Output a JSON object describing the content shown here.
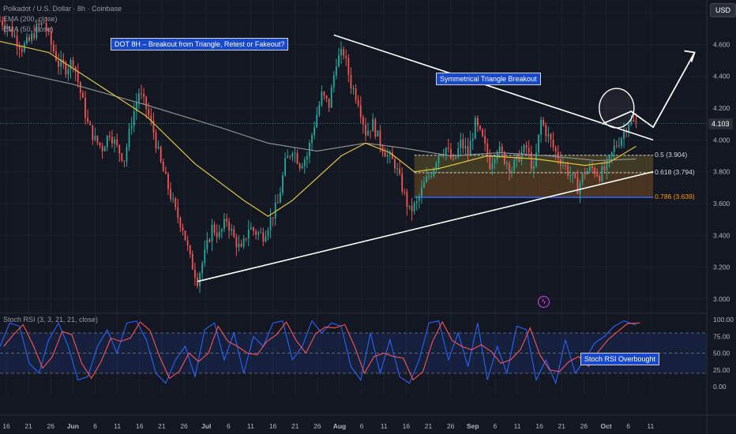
{
  "header": {
    "symbol_line": "Polkadot / U.S. Dollar · 8h · Coinbase",
    "ema200": "EMA (200, close)",
    "ema50": "EMA (50, close)",
    "currency": "USD"
  },
  "annotations": {
    "title": "DOT 8H – Breakout from Triangle, Retest or Fakeout?",
    "triangle": "Symmetrical Triangle Breakout",
    "stoch": "Stoch RSI Overbought"
  },
  "fib": [
    {
      "label": "0.5 (3.904)",
      "value": 3.904,
      "color": "#d1d4dc"
    },
    {
      "label": "0.618 (3.794)",
      "value": 3.794,
      "color": "#d1d4dc"
    },
    {
      "label": "0.786 (3.639)",
      "value": 3.639,
      "color": "#ff9800"
    }
  ],
  "colors": {
    "up": "#26a69a",
    "down": "#ef5350",
    "ema50": "#e0c341",
    "ema200": "#8d8d8d",
    "stochK": "#2962ff",
    "stochD": "#ff5252"
  },
  "chart_data": {
    "type": "candlestick",
    "current_price": 4.103,
    "current_price_label": "4.103",
    "price_ticks": [
      "4.800",
      "4.600",
      "4.400",
      "4.200",
      "4.000",
      "3.800",
      "3.600",
      "3.400",
      "3.200",
      "3.000"
    ],
    "price_tick_values": [
      4.8,
      4.6,
      4.4,
      4.2,
      4.0,
      3.8,
      3.6,
      3.4,
      3.2,
      3.0
    ],
    "ylim": [
      2.92,
      4.88
    ],
    "x_labels": [
      "16",
      "21",
      "26",
      "Jun",
      "6",
      "11",
      "16",
      "21",
      "26",
      "Jul",
      "6",
      "11",
      "16",
      "21",
      "26",
      "Aug",
      "6",
      "11",
      "16",
      "21",
      "26",
      "Sep",
      "6",
      "11",
      "16",
      "21",
      "26",
      "Oct",
      "6",
      "11"
    ],
    "close_path": [
      [
        0,
        4.75
      ],
      [
        3,
        4.72
      ],
      [
        6,
        4.65
      ],
      [
        9,
        4.58
      ],
      [
        12,
        4.62
      ],
      [
        15,
        4.7
      ],
      [
        18,
        4.74
      ],
      [
        21,
        4.6
      ],
      [
        24,
        4.48
      ],
      [
        27,
        4.45
      ],
      [
        30,
        4.5
      ],
      [
        33,
        4.3
      ],
      [
        36,
        4.1
      ],
      [
        39,
        4.0
      ],
      [
        42,
        3.95
      ],
      [
        45,
        4.05
      ],
      [
        48,
        3.95
      ],
      [
        51,
        3.88
      ],
      [
        54,
        4.12
      ],
      [
        57,
        4.3
      ],
      [
        60,
        4.2
      ],
      [
        63,
        4.05
      ],
      [
        66,
        3.85
      ],
      [
        69,
        3.7
      ],
      [
        72,
        3.55
      ],
      [
        75,
        3.45
      ],
      [
        78,
        3.25
      ],
      [
        81,
        3.12
      ],
      [
        84,
        3.28
      ],
      [
        87,
        3.45
      ],
      [
        90,
        3.4
      ],
      [
        93,
        3.5
      ],
      [
        96,
        3.38
      ],
      [
        99,
        3.3
      ],
      [
        102,
        3.45
      ],
      [
        105,
        3.42
      ],
      [
        108,
        3.4
      ],
      [
        111,
        3.5
      ],
      [
        114,
        3.6
      ],
      [
        117,
        3.85
      ],
      [
        120,
        3.95
      ],
      [
        123,
        3.85
      ],
      [
        126,
        3.9
      ],
      [
        129,
        4.1
      ],
      [
        132,
        4.28
      ],
      [
        135,
        4.22
      ],
      [
        138,
        4.5
      ],
      [
        141,
        4.55
      ],
      [
        144,
        4.35
      ],
      [
        147,
        4.25
      ],
      [
        150,
        4.05
      ],
      [
        153,
        4.1
      ],
      [
        156,
        3.98
      ],
      [
        159,
        3.9
      ],
      [
        162,
        3.85
      ],
      [
        165,
        3.7
      ],
      [
        168,
        3.55
      ],
      [
        171,
        3.6
      ],
      [
        174,
        3.72
      ],
      [
        177,
        3.8
      ],
      [
        180,
        3.92
      ],
      [
        183,
        3.95
      ],
      [
        186,
        3.85
      ],
      [
        189,
        3.98
      ],
      [
        192,
        3.92
      ],
      [
        195,
        4.1
      ],
      [
        198,
        4.0
      ],
      [
        201,
        3.85
      ],
      [
        204,
        3.95
      ],
      [
        207,
        3.88
      ],
      [
        210,
        3.82
      ],
      [
        213,
        3.9
      ],
      [
        216,
        3.95
      ],
      [
        219,
        3.8
      ],
      [
        222,
        4.12
      ],
      [
        225,
        4.02
      ],
      [
        228,
        3.92
      ],
      [
        231,
        3.85
      ],
      [
        234,
        3.78
      ],
      [
        237,
        3.7
      ],
      [
        240,
        3.8
      ],
      [
        243,
        3.82
      ],
      [
        246,
        3.78
      ],
      [
        249,
        3.83
      ],
      [
        252,
        3.95
      ],
      [
        255,
        4.02
      ],
      [
        258,
        4.12
      ],
      [
        261,
        4.1
      ]
    ],
    "ema50_path": [
      [
        0,
        4.62
      ],
      [
        20,
        4.55
      ],
      [
        40,
        4.35
      ],
      [
        60,
        4.15
      ],
      [
        80,
        3.85
      ],
      [
        100,
        3.62
      ],
      [
        110,
        3.52
      ],
      [
        120,
        3.62
      ],
      [
        140,
        3.9
      ],
      [
        150,
        3.98
      ],
      [
        160,
        3.92
      ],
      [
        170,
        3.8
      ],
      [
        180,
        3.82
      ],
      [
        200,
        3.9
      ],
      [
        220,
        3.88
      ],
      [
        240,
        3.84
      ],
      [
        250,
        3.86
      ],
      [
        261,
        3.96
      ]
    ],
    "ema200_path": [
      [
        0,
        4.45
      ],
      [
        30,
        4.35
      ],
      [
        60,
        4.22
      ],
      [
        90,
        4.08
      ],
      [
        110,
        3.98
      ],
      [
        130,
        3.93
      ],
      [
        150,
        3.98
      ],
      [
        165,
        3.95
      ],
      [
        185,
        3.9
      ],
      [
        205,
        3.92
      ],
      [
        225,
        3.9
      ],
      [
        245,
        3.87
      ],
      [
        261,
        3.88
      ]
    ],
    "trendlines": [
      {
        "name": "upper",
        "from": [
          137,
          4.66
        ],
        "to": [
          268,
          4.0
        ]
      },
      {
        "name": "lower",
        "from": [
          81,
          3.11
        ],
        "to": [
          268,
          3.8
        ]
      }
    ],
    "fib_zone": {
      "x_from": 170,
      "x_to": 268,
      "top": 3.904,
      "mid": 3.794,
      "bottom": 3.639
    },
    "projection": [
      [
        247,
        4.1
      ],
      [
        259,
        4.18
      ],
      [
        268,
        4.08
      ],
      [
        285,
        4.55
      ]
    ],
    "stoch": {
      "ticks": [
        "100.00",
        "75.00",
        "50.00",
        "25.00",
        "0.00"
      ],
      "tick_values": [
        100,
        75,
        50,
        25,
        0
      ],
      "band": [
        20,
        80
      ],
      "k_path": [
        [
          0,
          60
        ],
        [
          4,
          95
        ],
        [
          8,
          90
        ],
        [
          12,
          35
        ],
        [
          16,
          20
        ],
        [
          20,
          70
        ],
        [
          24,
          95
        ],
        [
          28,
          60
        ],
        [
          32,
          10
        ],
        [
          36,
          15
        ],
        [
          40,
          60
        ],
        [
          44,
          85
        ],
        [
          48,
          50
        ],
        [
          52,
          95
        ],
        [
          56,
          98
        ],
        [
          60,
          70
        ],
        [
          64,
          20
        ],
        [
          68,
          5
        ],
        [
          72,
          40
        ],
        [
          76,
          60
        ],
        [
          80,
          15
        ],
        [
          84,
          85
        ],
        [
          88,
          95
        ],
        [
          92,
          40
        ],
        [
          96,
          80
        ],
        [
          100,
          20
        ],
        [
          104,
          75
        ],
        [
          108,
          60
        ],
        [
          112,
          95
        ],
        [
          116,
          98
        ],
        [
          120,
          40
        ],
        [
          124,
          60
        ],
        [
          128,
          98
        ],
        [
          132,
          80
        ],
        [
          136,
          95
        ],
        [
          140,
          90
        ],
        [
          144,
          30
        ],
        [
          148,
          10
        ],
        [
          152,
          80
        ],
        [
          156,
          20
        ],
        [
          160,
          70
        ],
        [
          164,
          15
        ],
        [
          168,
          5
        ],
        [
          172,
          40
        ],
        [
          176,
          95
        ],
        [
          180,
          98
        ],
        [
          184,
          40
        ],
        [
          188,
          80
        ],
        [
          192,
          30
        ],
        [
          196,
          95
        ],
        [
          200,
          10
        ],
        [
          204,
          60
        ],
        [
          208,
          20
        ],
        [
          212,
          90
        ],
        [
          216,
          85
        ],
        [
          220,
          10
        ],
        [
          224,
          40
        ],
        [
          228,
          5
        ],
        [
          232,
          70
        ],
        [
          236,
          20
        ],
        [
          240,
          40
        ],
        [
          244,
          65
        ],
        [
          248,
          75
        ],
        [
          252,
          90
        ],
        [
          256,
          98
        ],
        [
          261,
          92
        ]
      ]
    }
  }
}
